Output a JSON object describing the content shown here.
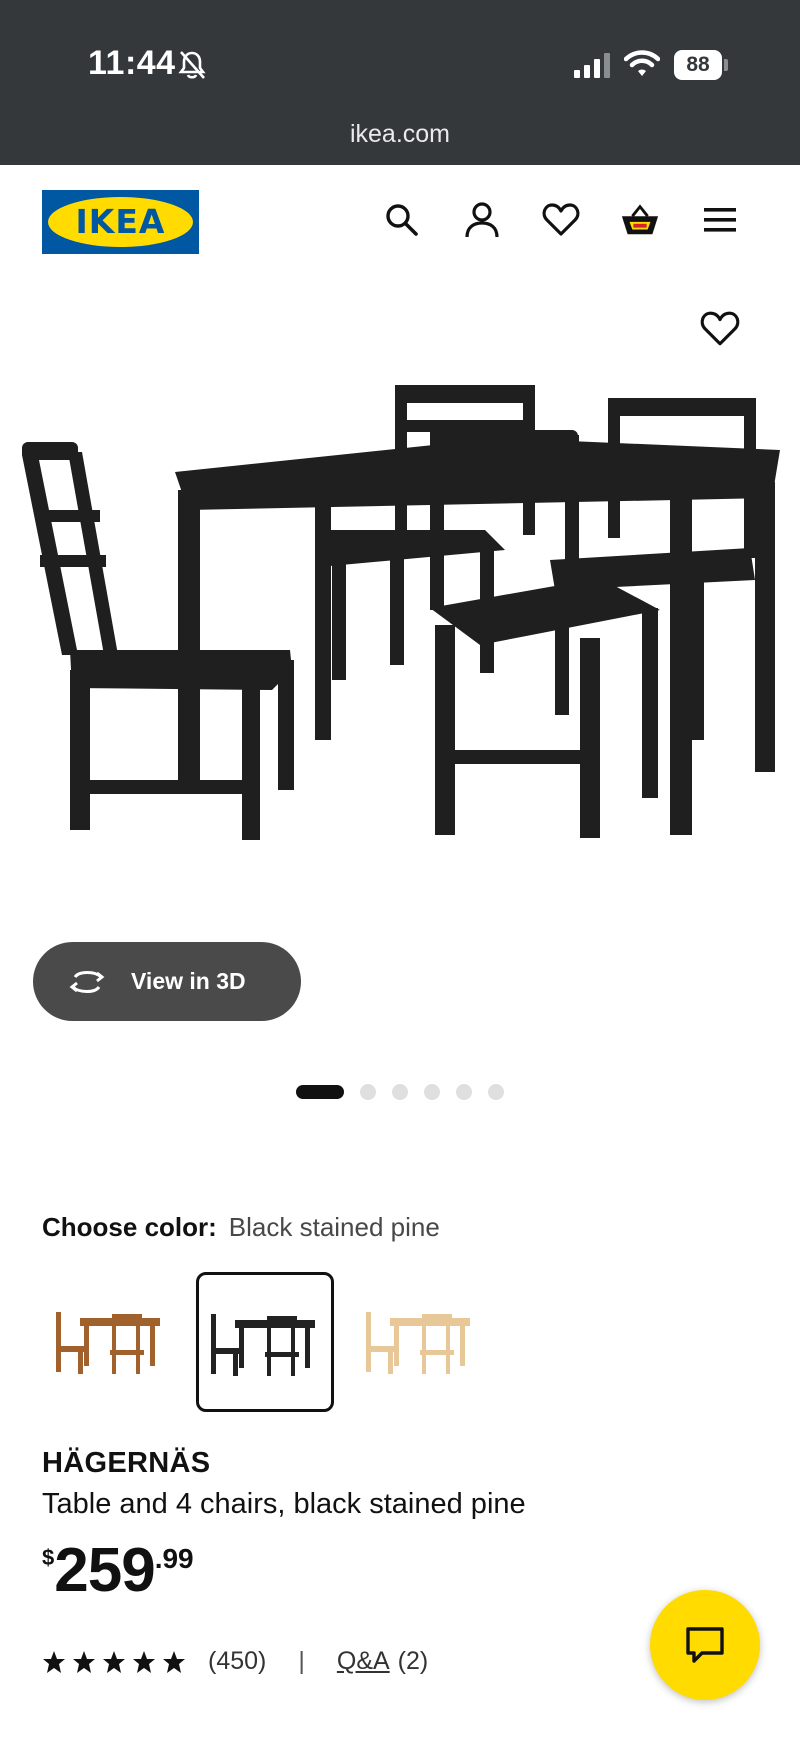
{
  "status_bar": {
    "time": "11:44",
    "battery": "88",
    "url": "ikea.com"
  },
  "header": {
    "logo_text": "IKEA",
    "icons": [
      "search-icon",
      "account-icon",
      "heart-icon",
      "basket-icon",
      "menu-icon"
    ]
  },
  "gallery": {
    "view_3d_label": "View in 3D",
    "slide_count": 6,
    "active_slide": 1
  },
  "color_picker": {
    "label": "Choose color:",
    "selected_value": "Black stained pine",
    "swatches": [
      "brown",
      "black",
      "natural"
    ]
  },
  "product": {
    "name": "HÄGERNÄS",
    "description": "Table and 4 chairs, black stained pine",
    "price_currency": "$",
    "price_main": "259",
    "price_cents": ".99"
  },
  "reviews": {
    "stars": 5,
    "count": "(450)",
    "separator": "|",
    "qa_link": "Q&A",
    "qa_count": "(2)"
  },
  "colors": {
    "status_bar_bg": "#34383b",
    "ikea_blue": "#0058a3",
    "ikea_yellow": "#ffdb00",
    "furniture_black": "#1f1f1f"
  }
}
